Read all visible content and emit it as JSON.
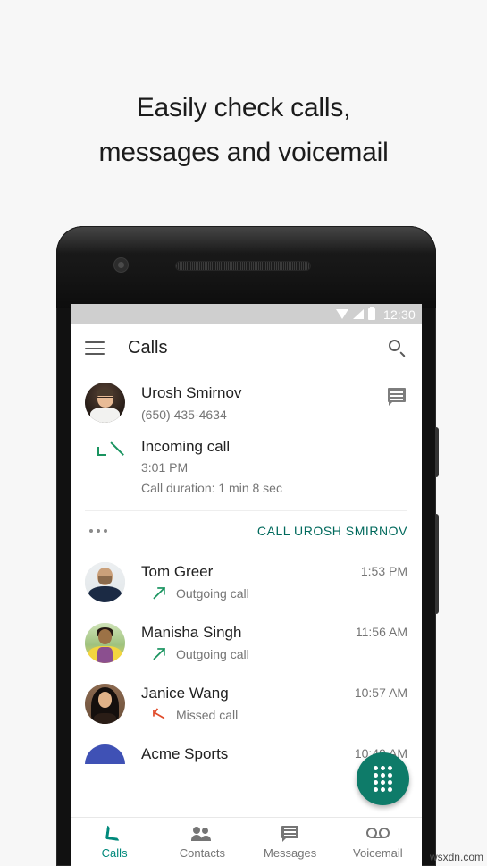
{
  "headline": {
    "line1": "Easily check calls,",
    "line2": "messages and voicemail"
  },
  "colors": {
    "accent_teal": "#00897b",
    "action_teal": "#00695c",
    "fab_teal": "#0e7b69",
    "incoming_green": "#1a9460",
    "missed_red": "#e04b2a",
    "statusbar_gray": "#cfcfcf",
    "secondary_text": "#757575",
    "primary_text": "#212121"
  },
  "phone": {
    "statusbar": {
      "time": "12:30",
      "icons": [
        "wifi-icon",
        "signal-icon",
        "battery-icon"
      ]
    },
    "appbar": {
      "menu_icon": "hamburger-menu-icon",
      "title": "Calls",
      "search_icon": "search-icon"
    },
    "expanded_call": {
      "avatar": "urosh-smirnov-avatar",
      "name": "Urosh Smirnov",
      "number": "(650) 435-4634",
      "message_icon": "message-bubble-icon",
      "direction_icon": "incoming-call-arrow-icon",
      "call_type": "Incoming call",
      "time": "3:01 PM",
      "duration": "Call duration: 1 min 8 sec",
      "overflow_icon": "more-options-icon",
      "action_label": "CALL UROSH SMIRNOV"
    },
    "call_log": [
      {
        "avatar": "tom-greer-avatar",
        "name": "Tom Greer",
        "time": "1:53 PM",
        "type": "Outgoing call",
        "direction": "out"
      },
      {
        "avatar": "manisha-singh-avatar",
        "name": "Manisha Singh",
        "time": "11:56 AM",
        "type": "Outgoing call",
        "direction": "out"
      },
      {
        "avatar": "janice-wang-avatar",
        "name": "Janice Wang",
        "time": "10:57 AM",
        "type": "Missed call",
        "direction": "missed"
      },
      {
        "avatar": "acme-sports-avatar",
        "name": "Acme Sports",
        "time": "10:49 AM",
        "type": "",
        "direction": "out"
      }
    ],
    "fab": {
      "icon": "dialpad-icon"
    },
    "bottom_nav": [
      {
        "icon": "phone-handset-icon",
        "label": "Calls",
        "active": true
      },
      {
        "icon": "contacts-people-icon",
        "label": "Contacts",
        "active": false
      },
      {
        "icon": "messages-bubble-icon",
        "label": "Messages",
        "active": false
      },
      {
        "icon": "voicemail-icon",
        "label": "Voicemail",
        "active": false
      }
    ]
  },
  "watermark": "wsxdn.com"
}
